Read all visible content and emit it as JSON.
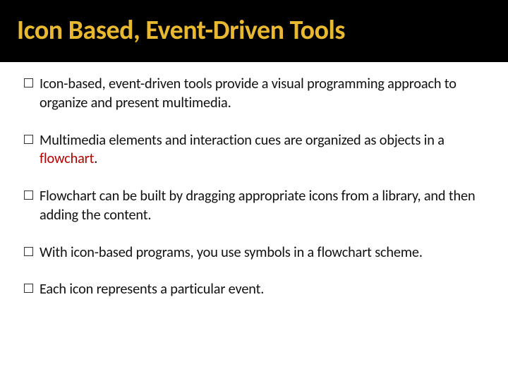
{
  "title": "Icon Based, Event-Driven Tools",
  "bullets": {
    "b0": {
      "text": "Icon-based, event-driven tools provide a visual programming approach to organize and present multimedia."
    },
    "b1": {
      "pre": "Multimedia elements and interaction cues are organized as objects in a ",
      "hl": "flowchart",
      "post": "."
    },
    "b2": {
      "text": "Flowchart can be built by dragging appropriate icons from a library, and then adding the content."
    },
    "b3": {
      "text": "With icon-based programs, you use symbols in a flowchart scheme."
    },
    "b4": {
      "text": "Each icon represents a particular event."
    }
  }
}
